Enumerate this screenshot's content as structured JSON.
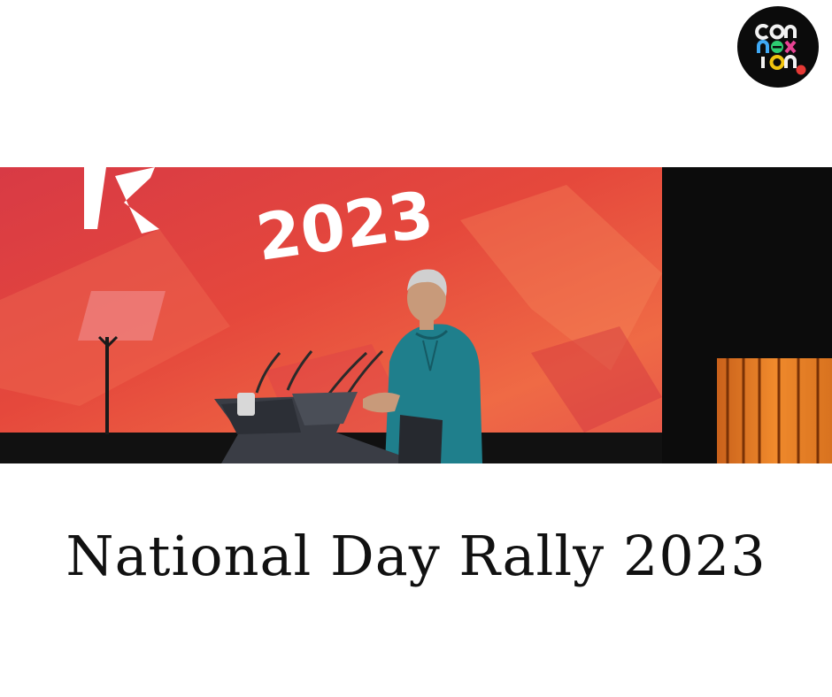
{
  "logo": {
    "wordmark": [
      "con",
      "nex",
      "ion"
    ],
    "icon": "connexion-logo-icon"
  },
  "photo": {
    "screen_text": "2023",
    "icon": "rally-stage-photo"
  },
  "caption": "National Day Rally 2023",
  "colors": {
    "background": "#ffffff",
    "screen_red": "#e2443f",
    "shirt_teal": "#1f7f8c",
    "text": "#111111"
  }
}
